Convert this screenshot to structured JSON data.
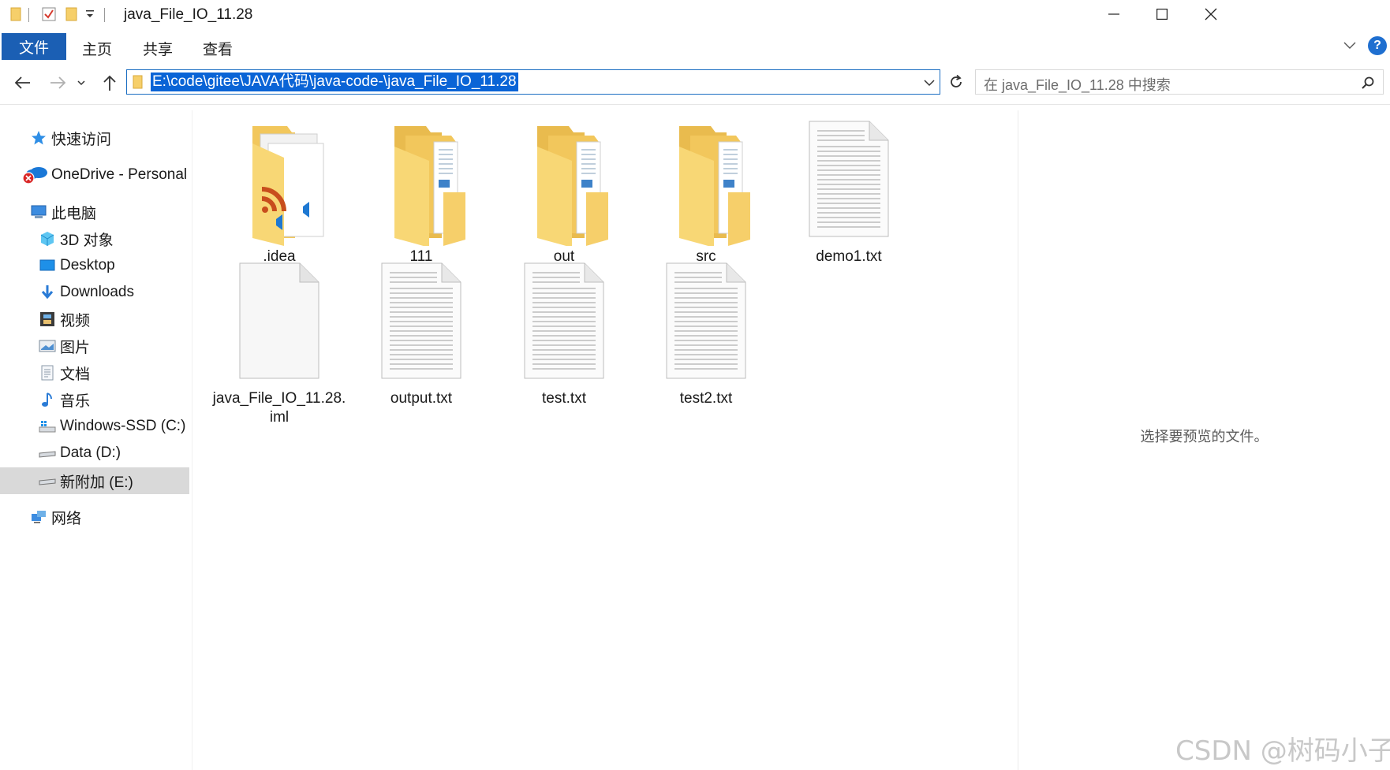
{
  "window": {
    "title": "java_File_IO_11.28",
    "controls": [
      "minimize",
      "maximize",
      "close"
    ]
  },
  "ribbon": {
    "file_tab": "文件",
    "tabs": [
      "主页",
      "共享",
      "查看"
    ],
    "help": "?"
  },
  "address": {
    "path": "E:\\code\\gitee\\JAVA代码\\java-code-\\java_File_IO_11.28",
    "search_placeholder": "在 java_File_IO_11.28 中搜索"
  },
  "sidebar": {
    "items": [
      {
        "label": "快速访问",
        "icon": "star-icon"
      },
      {
        "label": "OneDrive - Personal",
        "icon": "onedrive-error-icon"
      },
      {
        "label": "此电脑",
        "icon": "computer-icon"
      },
      {
        "label": "3D 对象",
        "icon": "cube-3d-icon"
      },
      {
        "label": "Desktop",
        "icon": "desktop-icon"
      },
      {
        "label": "Downloads",
        "icon": "download-arrow-icon"
      },
      {
        "label": "视频",
        "icon": "video-film-icon"
      },
      {
        "label": "图片",
        "icon": "picture-icon"
      },
      {
        "label": "文档",
        "icon": "document-icon"
      },
      {
        "label": "音乐",
        "icon": "music-note-icon"
      },
      {
        "label": "Windows-SSD (C:)",
        "icon": "windows-drive-icon"
      },
      {
        "label": "Data (D:)",
        "icon": "drive-icon"
      },
      {
        "label": "新附加 (E:)",
        "icon": "drive-icon"
      },
      {
        "label": "网络",
        "icon": "network-icon"
      }
    ],
    "selected": "新附加 (E:)"
  },
  "files": [
    {
      "name": ".idea",
      "type": "folder-idea"
    },
    {
      "name": "111",
      "type": "folder"
    },
    {
      "name": "out",
      "type": "folder"
    },
    {
      "name": "src",
      "type": "folder"
    },
    {
      "name": "demo1.txt",
      "type": "text"
    },
    {
      "name": "java_File_IO_11.28.iml",
      "type": "blank"
    },
    {
      "name": "output.txt",
      "type": "text"
    },
    {
      "name": "test.txt",
      "type": "text"
    },
    {
      "name": "test2.txt",
      "type": "text"
    }
  ],
  "preview": {
    "message": "选择要预览的文件。"
  },
  "watermark": "CSDN @树码小子",
  "colors": {
    "accent": "#1b5fb4",
    "selection": "#0a64d6",
    "folder": "#f6cf6a",
    "sidebar_selected": "#d9d9d9"
  }
}
